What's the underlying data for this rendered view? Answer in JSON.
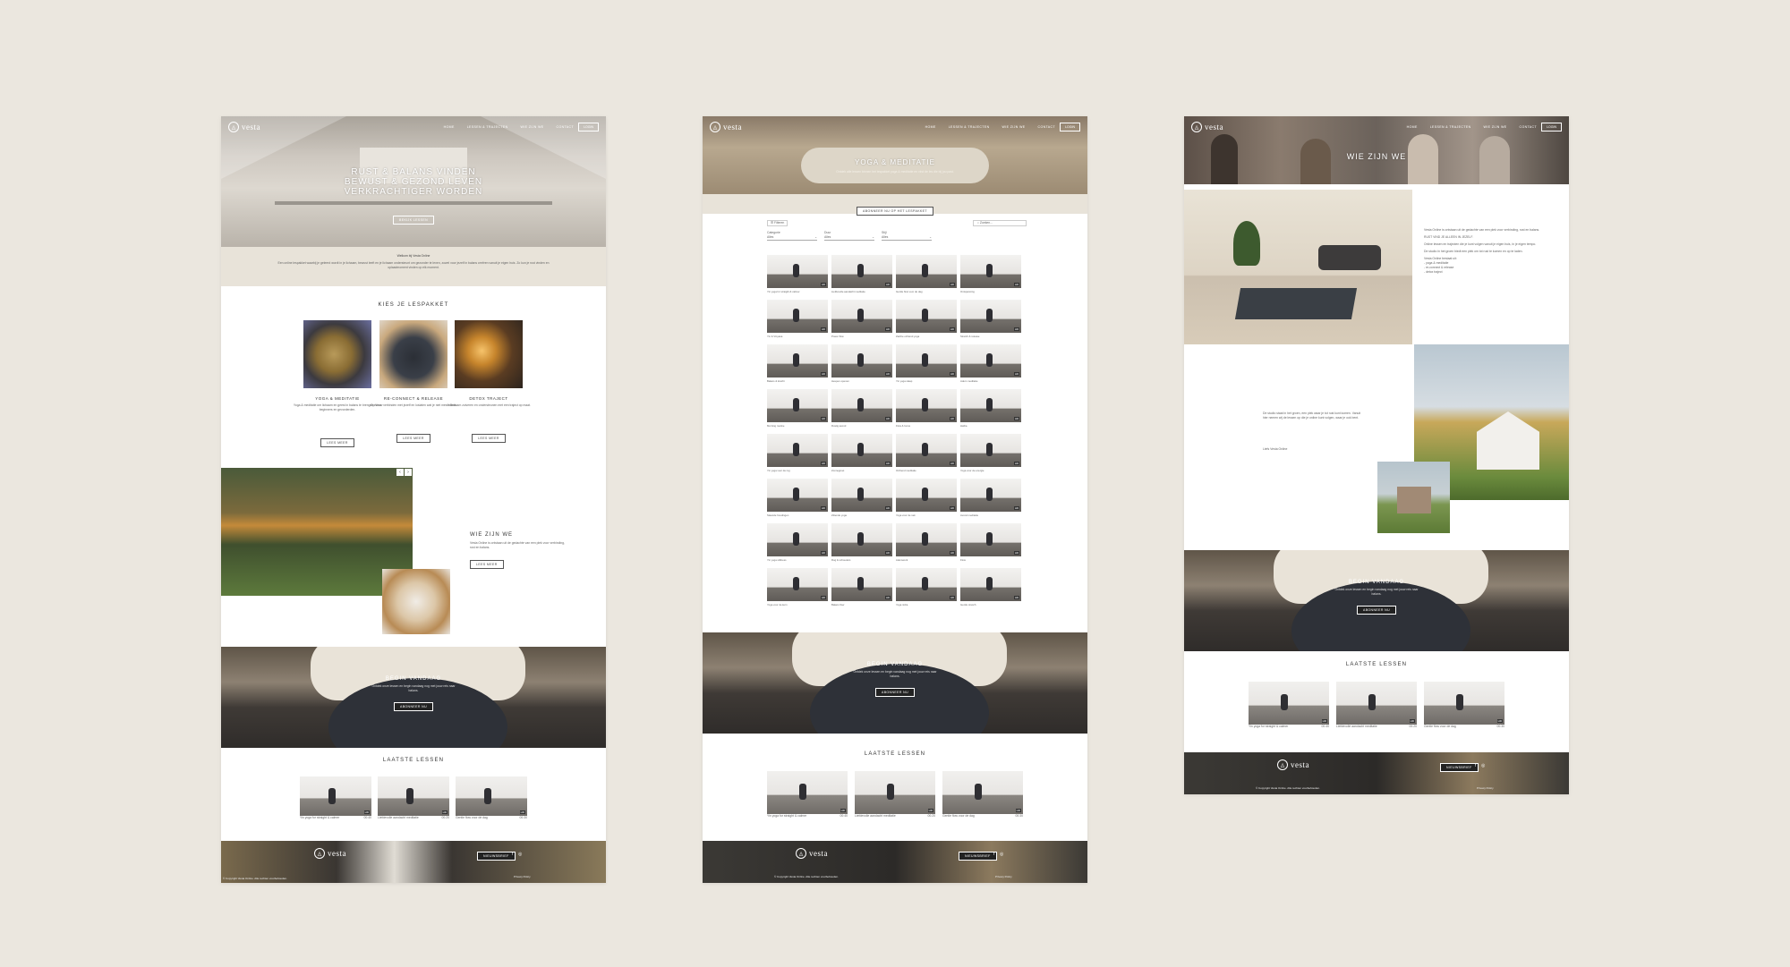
{
  "colors": {
    "background": "#ebe7df",
    "accent_beige": "#e8e3d9",
    "dark": "#222222"
  },
  "brand": {
    "logo_text": "vesta",
    "logo_sub": "online"
  },
  "nav": {
    "items": [
      "HOME",
      "LESSEN & TRAJECTEN",
      "WIE ZIJN WE",
      "CONTACT"
    ],
    "login": "LOGIN"
  },
  "page1": {
    "hero_lines": [
      "RUST & BALANS VINDEN",
      "BEWUST & GEZOND LEVEN",
      "VERKRACHTIGER WORDEN"
    ],
    "hero_button": "BEKIJK LESSEN",
    "welcome_title": "Welkom bij Vesta Online",
    "welcome_text": "Een online lespakket waarbij je geleerd wordt in je lichaam, bewust leeft en je lichaam ondersteunt om gezonder te leven, zowel voor jezelf in balans creëren vanuit je eigen huis. Zo kun je rust vinden en oplaadmoment vinden op elk moment.",
    "packages_title": "KIES JE LESPAKKET",
    "packages": [
      {
        "title": "YOGA & MEDITATIE",
        "text": "Yoga & meditatie om lichaam en geest in balans te brengen. Voor beginners en gevorderden.",
        "button": "LEES MEER"
      },
      {
        "title": "RE-CONNECT & RELEASE",
        "text": "Opnieuw verbinden met jezelf en loslaten wat je niet meer dient.",
        "button": "LEES MEER"
      },
      {
        "title": "DETOX TRAJECT",
        "text": "Je lichaam zuiveren en ondersteunen met een traject op maat.",
        "button": "LEES MEER"
      }
    ],
    "who_title": "WIE ZIJN WE",
    "who_text": "Vesta Online is ontstaan uit de gedachte van een plek voor verbinding, rust en balans.",
    "who_button": "LEES MEER",
    "cta_title": "BEGIN VANDAAG",
    "cta_text": "Ontdek onze lessen en begin vandaag nog met jouw reis naar balans.",
    "cta_button": "ABONNEER NU",
    "latest_title": "LAATSTE LESSEN",
    "lessons": [
      {
        "title": "Yin yoga for straight & calmer",
        "dur": "00:40",
        "tag": "HD"
      },
      {
        "title": "Liefdevolle aandacht meditatie",
        "dur": "00:20",
        "tag": "HD"
      },
      {
        "title": "Gentle flow voor de dag",
        "dur": "00:30",
        "tag": "HD"
      }
    ],
    "footer_button": "NIEUWSBRIEF",
    "footer_copyright": "© Copyright Vesta Online. Alle rechten voorbehouden.",
    "footer_privacy": "Privacy Policy"
  },
  "page2": {
    "hero_title": "YOGA & MEDITATIE",
    "hero_sub": "Ontdek alle lessen binnen het lespakket yoga & meditatie en vind de les die bij jou past.",
    "notice_button": "ABONNEER NU OP HET LESPAKKET",
    "filter_all": "Filteren",
    "search_placeholder": "Zoeken...",
    "filter_labels": [
      "Categorie",
      "Duur",
      "Stijl"
    ],
    "filter_values": [
      "Alles",
      "Alles",
      "Alles"
    ],
    "grid_labels": [
      "Yin yoga for straight & calmer",
      "Liefdevolle aandacht meditatie",
      "Gentle flow voor de dag",
      "Ontspanning",
      "Yin & Vinyasa",
      "Power flow",
      "Zachte ochtend yoga",
      "Stretch & release",
      "Balans & kracht",
      "Heupen openen",
      "Yin yoga slaap",
      "Adem meditatie",
      "Morning routine",
      "Rustig avond",
      "Flow & focus",
      "Hatha",
      "Yin yoga voor de rug",
      "Zonnegroet",
      "Ochtend meditatie",
      "Yoga voor de energie",
      "Staande houdingen",
      "Zittende yoga",
      "Yoga voor de nek",
      "Avond meditatie",
      "Yin yoga stillness",
      "Rug & schouders",
      "Ademwerk",
      "Flow",
      "Yoga voor de kern",
      "Balans flow",
      "Yoga nidra",
      "Gentle stretch"
    ],
    "cta_title": "BEGIN VANDAAG",
    "cta_text": "Ontdek onze lessen en begin vandaag nog met jouw reis naar balans.",
    "cta_button": "ABONNEER NU",
    "latest_title": "LAATSTE LESSEN",
    "lessons": [
      {
        "title": "Yin yoga for straight & calmer",
        "dur": "00:40",
        "tag": "HD"
      },
      {
        "title": "Liefdevolle aandacht meditatie",
        "dur": "00:20",
        "tag": "HD"
      },
      {
        "title": "Gentle flow voor de dag",
        "dur": "00:30",
        "tag": "HD"
      }
    ],
    "footer_button": "NIEUWSBRIEF",
    "footer_copyright": "© Copyright Vesta Online. Alle rechten voorbehouden.",
    "footer_privacy": "Privacy Policy"
  },
  "page3": {
    "hero_title": "WIE ZIJN WE",
    "intro_lines": [
      "Vesta Online is ontstaan uit de gedachte van een plek voor verbinding, rust en balans.",
      "RUST VIND JE ALLEEN IN JEZELF.",
      "Online lessen en trajecten die je kunt volgen vanuit je eigen huis, in je eigen tempo.",
      "De studio in het groen biedt een plek om tot rust te komen en op te laden.",
      "Vesta Online bestaat uit:",
      "- yoga & meditatie",
      "- re-connect & release",
      "- detox traject"
    ],
    "story_text": "De studio staat in het groen, een plek waar je tot rust kunt komen. Vanuit hier nemen wij de lessen op die je online kunt volgen, waar je ook bent.",
    "story_sign": "Liefs Vesta Online",
    "cta_title": "BEGIN VANDAAG",
    "cta_text": "Ontdek onze lessen en begin vandaag nog met jouw reis naar balans.",
    "cta_button": "ABONNEER NU",
    "latest_title": "LAATSTE LESSEN",
    "lessons": [
      {
        "title": "Yin yoga for straight & calmer",
        "dur": "00:40",
        "tag": "HD"
      },
      {
        "title": "Liefdevolle aandacht meditatie",
        "dur": "00:20",
        "tag": "HD"
      },
      {
        "title": "Gentle flow voor de dag",
        "dur": "00:30",
        "tag": "HD"
      }
    ],
    "footer_button": "NIEUWSBRIEF",
    "footer_copyright": "© Copyright Vesta Online. Alle rechten voorbehouden.",
    "footer_privacy": "Privacy Policy"
  }
}
